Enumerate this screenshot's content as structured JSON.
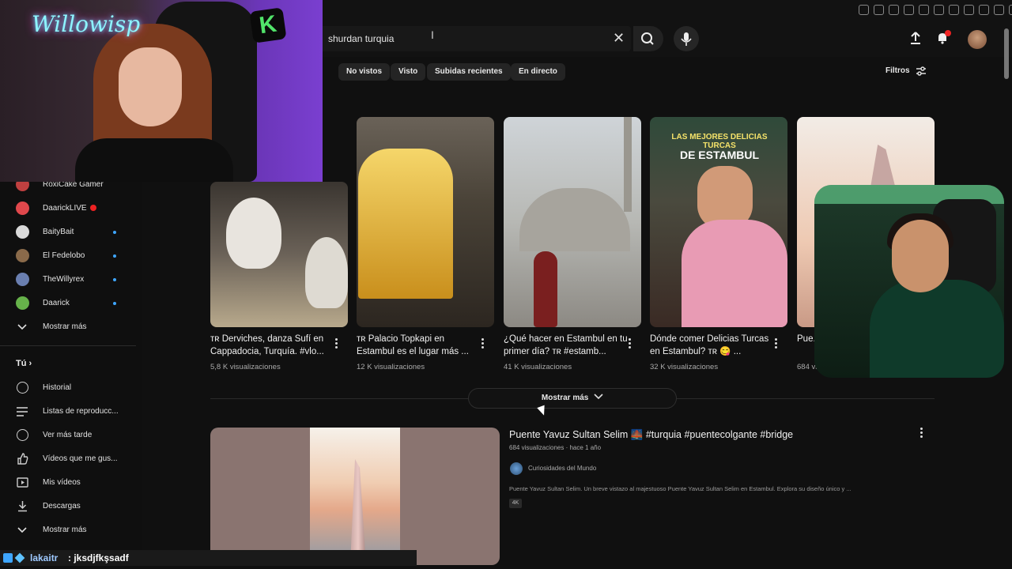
{
  "search": {
    "query": "shurdan turquia"
  },
  "chips": [
    "No vistos",
    "Visto",
    "Subidas recientes",
    "En directo"
  ],
  "filters_label": "Filtros",
  "sidebar": {
    "subscriptions": [
      {
        "label": "RoxiCake Gamer",
        "color": "#c04040"
      },
      {
        "label": "DaarickLIVE",
        "color": "#e0484c",
        "live": true
      },
      {
        "label": "BaityBait",
        "color": "#d9d9d9"
      },
      {
        "label": "El Fedelobo",
        "color": "#8a6a4a"
      },
      {
        "label": "TheWillyrex",
        "color": "#6a7fb0"
      },
      {
        "label": "Daarick",
        "color": "#66b24a"
      }
    ],
    "show_more_subs": "Mostrar más",
    "you_header": "Tú",
    "you_items": [
      {
        "label": "Historial",
        "icon": "history-icon"
      },
      {
        "label": "Listas de reproducc...",
        "icon": "playlist-icon"
      },
      {
        "label": "Ver más tarde",
        "icon": "clock-icon"
      },
      {
        "label": "Vídeos que me gus...",
        "icon": "thumbs-up-icon"
      },
      {
        "label": "Mis vídeos",
        "icon": "my-videos-icon"
      },
      {
        "label": "Descargas",
        "icon": "download-icon"
      },
      {
        "label": "Mostrar más",
        "icon": "chevron-down-icon"
      }
    ]
  },
  "shorts": [
    {
      "title": "ᴛʀ Derviches, danza Sufí en Cappadocia, Turquía. #vlo...",
      "views": "5,8 K visualizaciones"
    },
    {
      "title": "ᴛʀ Palacio Topkapi en Estambul es el lugar más ...",
      "views": "12 K visualizaciones"
    },
    {
      "title": "¿Qué hacer en Estambul en tu primer día? ᴛʀ #estamb...",
      "views": "41 K visualizaciones"
    },
    {
      "title": "Dónde comer Delicias Turcas en Estambul? ᴛʀ 😋 ...",
      "views": "32 K visualizaciones"
    },
    {
      "title": "Pue...",
      "views": "684 vi..."
    }
  ],
  "short_overlays": {
    "food_top": "LAS MEJORES DELICIAS TURCAS",
    "food_bottom": "DE ESTAMBUL"
  },
  "show_more": "Mostrar más",
  "result": {
    "title": "Puente Yavuz Sultan Selim 🌉 #turquia #puentecolgante #bridge",
    "meta": "684 visualizaciones · hace 1 año",
    "channel": "Curiosidades del Mundo",
    "description": "Puente Yavuz Sultan Selim. Un breve vistazo al majestuoso Puente Yavuz Sultan Selim en Estambul. Explora su diseño único y ...",
    "badge": "4K"
  },
  "stream": {
    "neon_sign": "Willowisp",
    "k_logo": "K"
  },
  "chat": {
    "user": "lakaitr",
    "message": ": jksdjfkşsadf"
  }
}
